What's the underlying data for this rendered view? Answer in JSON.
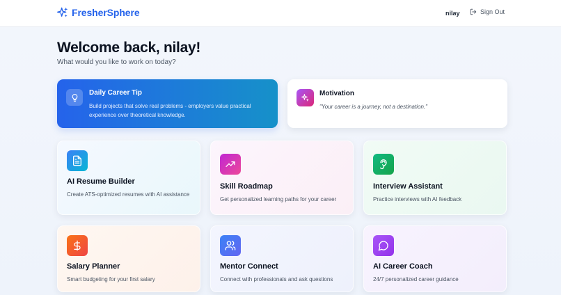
{
  "header": {
    "brand": "FresherSphere",
    "user": "nilay",
    "signout_label": "Sign Out"
  },
  "welcome": {
    "title": "Welcome back, nilay!",
    "subtitle": "What would you like to work on today?"
  },
  "tip": {
    "title": "Daily Career Tip",
    "text": "Build projects that solve real problems - employers value practical experience over theoretical knowledge."
  },
  "motivation": {
    "title": "Motivation",
    "quote": "\"Your career is a journey, not a destination.\""
  },
  "cards": [
    {
      "title": "AI Resume Builder",
      "desc": "Create ATS-optimized resumes with AI assistance",
      "icon": "document-icon",
      "color": "#0ea5e9"
    },
    {
      "title": "Skill Roadmap",
      "desc": "Get personalized learning paths for your career",
      "icon": "trending-up-icon",
      "color": "#c026d3"
    },
    {
      "title": "Interview Assistant",
      "desc": "Practice interviews with AI feedback",
      "icon": "ear-icon",
      "color": "#10b981"
    },
    {
      "title": "Salary Planner",
      "desc": "Smart budgeting for your first salary",
      "icon": "dollar-icon",
      "color": "#ef4444"
    },
    {
      "title": "Mentor Connect",
      "desc": "Connect with professionals and ask questions",
      "icon": "users-icon",
      "color": "#6366f1"
    },
    {
      "title": "AI Career Coach",
      "desc": "24/7 personalized career guidance",
      "icon": "chat-icon",
      "color": "#a855f7"
    }
  ],
  "colors": {
    "brand": "#2563eb",
    "tip_gradient_start": "#2563eb",
    "tip_gradient_end": "#1691c9"
  }
}
